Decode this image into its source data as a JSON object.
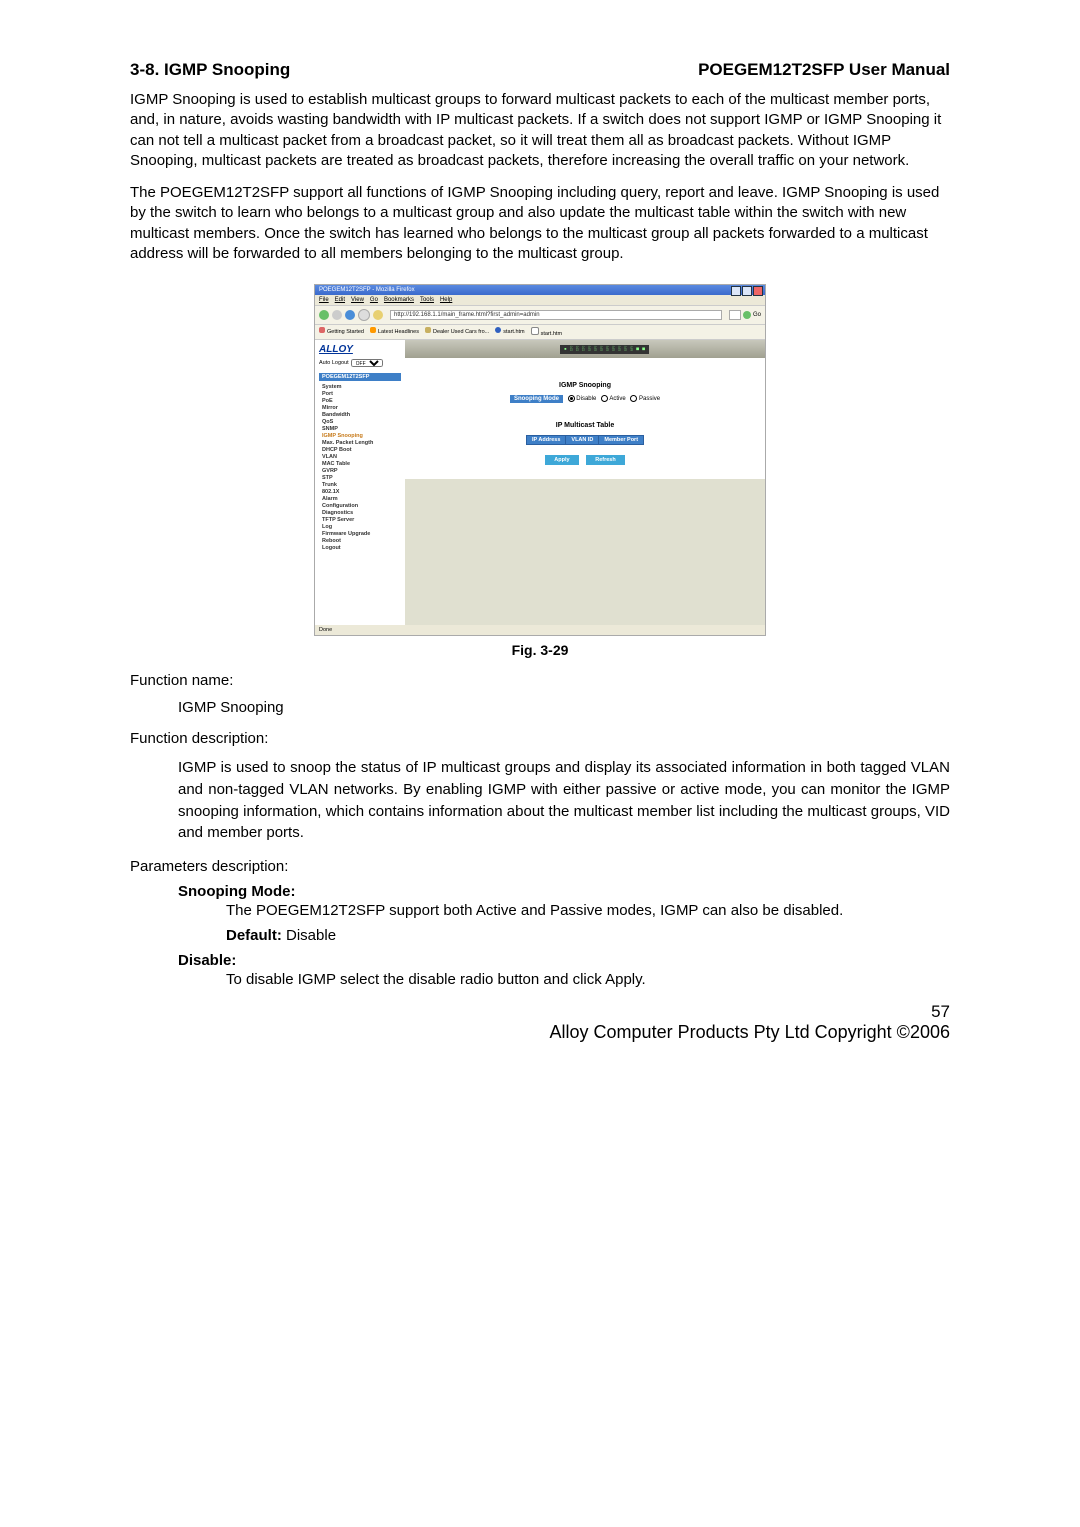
{
  "header": {
    "section": "3-8. IGMP Snooping",
    "manual": "POEGEM12T2SFP User Manual"
  },
  "para1": "IGMP Snooping is used to establish multicast groups to forward multicast packets to each of the multicast member ports, and, in nature, avoids wasting bandwidth with IP multicast packets. If a switch does not support IGMP or IGMP Snooping it can not tell a multicast packet from a broadcast packet, so it will treat them all as broadcast packets. Without IGMP Snooping, multicast packets are treated as broadcast packets, therefore increasing the overall traffic on your network.",
  "para2": "The POEGEM12T2SFP support all functions of IGMP Snooping including query, report and leave. IGMP Snooping is used by the switch to learn who belongs to a multicast group and also update the multicast table within the switch with new multicast members. Once the switch has learned who belongs to the multicast group all packets forwarded to a multicast address will be forwarded to all members belonging to the multicast group.",
  "screenshot": {
    "window_title": "POEGEM12T2SFP - Mozilla Firefox",
    "menus": {
      "file": "File",
      "edit": "Edit",
      "view": "View",
      "go": "Go",
      "bookmarks": "Bookmarks",
      "tools": "Tools",
      "help": "Help"
    },
    "url": "http://192.168.1.1/main_frame.html?first_admin=admin",
    "go_label": "Go",
    "bookmarks_bar": {
      "gs": "Getting Started",
      "lh": "Latest Headlines",
      "dl": "Dealer Used Cars fro...",
      "st": "start.htm",
      "st2": "start.htm"
    },
    "sidebar": {
      "brand": "ALLOY",
      "auto_logout_label": "Auto Logout",
      "auto_logout_value": "OFF",
      "header": "POEGEM12T2SFP",
      "items": [
        "System",
        "Port",
        "PoE",
        "Mirror",
        "Bandwidth",
        "QoS",
        "SNMP",
        "IGMP Snooping",
        "Max. Packet Length",
        "DHCP Boot",
        "VLAN",
        "MAC Table",
        "GVRP",
        "STP",
        "Trunk",
        "802.1X",
        "Alarm",
        "Configuration",
        "Diagnostics",
        "TFTP Server",
        "Log",
        "Firmware Upgrade",
        "Reboot",
        "Logout"
      ],
      "active": "IGMP Snooping"
    },
    "main": {
      "router_ports": "▪ ░ ░ ░ ░ ░ ░ ░ ░ ░ ░ ░  ■ ■",
      "title1": "IGMP Snooping",
      "mode_label": "Snooping Mode",
      "opt_disable": "Disable",
      "opt_active": "Active",
      "opt_passive": "Passive",
      "title2": "IP Multicast Table",
      "th1": "IP Address",
      "th2": "VLAN ID",
      "th3": "Member Port",
      "btn_apply": "Apply",
      "btn_refresh": "Refresh"
    },
    "status": "Done"
  },
  "fig_caption": "Fig. 3-29",
  "fn_label": "Function name:",
  "fn_value": "IGMP Snooping",
  "fd_label": "Function description:",
  "fd_body": "IGMP is used to snoop the status of IP multicast groups and display its associated information in both tagged VLAN and non-tagged VLAN networks. By enabling IGMP with either passive or active mode, you can monitor the IGMP snooping information, which contains information about the multicast member list including the multicast groups, VID and member ports.",
  "pd_label": "Parameters description:",
  "p1_head": "Snooping Mode:",
  "p1_body": "The POEGEM12T2SFP support both Active and Passive modes, IGMP can also be disabled.",
  "p1_def_label": "Default:",
  "p1_def_val": " Disable",
  "p2_head": "Disable:",
  "p2_body": "To disable IGMP select the disable radio button and click Apply.",
  "page_num": "57",
  "copyright": "Alloy Computer Products Pty Ltd Copyright ©2006"
}
